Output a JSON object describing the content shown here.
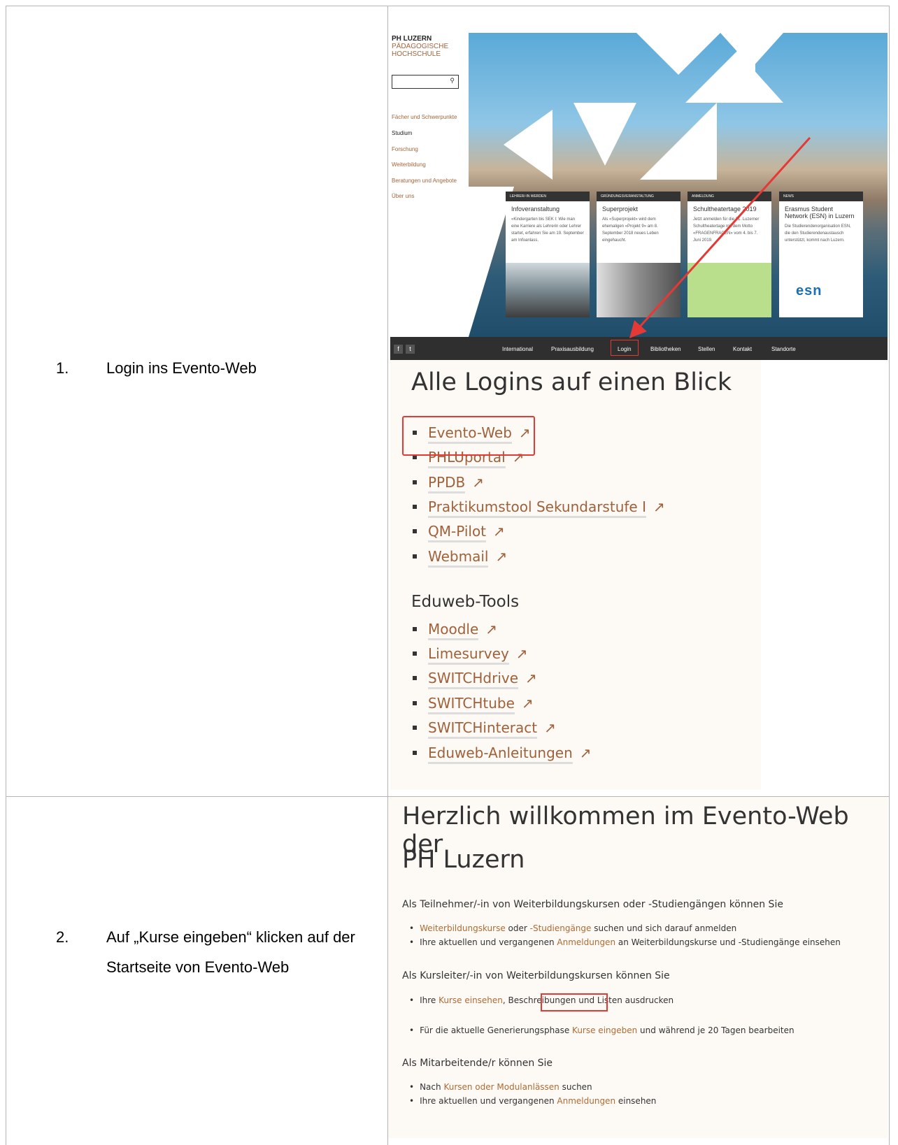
{
  "steps": [
    {
      "num": "1.",
      "text": "Login ins Evento-Web"
    },
    {
      "num": "2.",
      "text": "Auf „Kurse eingeben“ klicken auf der Startseite von Evento-Web"
    }
  ],
  "phlu": {
    "logo_line1": "PH LUZERN",
    "logo_line2": "PÄDAGOGISCHE HOCHSCHULE",
    "search_icon": "search-icon",
    "nav": [
      "Fächer und Schwerpunkte",
      "Studium",
      "Forschung",
      "Weiterbildung",
      "Beratungen und Angebote",
      "Über uns"
    ],
    "cards": [
      {
        "category": "LEHRER/-IN WERDEN",
        "title": "Infoveranstaltung",
        "body": "«Kindergarten bis SEK I: Wie man eine Karriere als Lehrerin oder Lehrer startet, erfahren Sie am 19. September am Infoanlass."
      },
      {
        "category": "GRÜNDUNGSVERANSTALTUNG",
        "title": "Superprojekt",
        "body": "Als «Superprojekt» wird dem ehemaligen «Projekt 9» am 8. September 2018 neues Leben eingehaucht."
      },
      {
        "category": "ANMELDUNG",
        "title": "Schultheatertage 2019",
        "body": "Jetzt anmelden für die 31. Luzerner Schultheatertage mit dem Motto «FRAGENFRAGEN» vom 4. bis 7. Juni 2019."
      },
      {
        "category": "NEWS",
        "title": "Erasmus Student Network (ESN) in Luzern",
        "body": "Die Studierendenorganisation ESN, die den Studierendenaustausch unterstützt, kommt nach Luzern."
      }
    ],
    "esn_logo": "esn",
    "social": [
      "f",
      "t"
    ],
    "footer_nav": [
      "International",
      "Praxisausbildung",
      "Login",
      "Bibliotheken",
      "Stellen",
      "Kontakt",
      "Standorte"
    ]
  },
  "logins": {
    "title": "Alle Logins auf einen Blick",
    "links": [
      "Evento-Web",
      "PHLUportal",
      "PPDB",
      "Praktikumstool Sekundarstufe I",
      "QM-Pilot",
      "Webmail"
    ],
    "subtitle": "Eduweb-Tools",
    "tools": [
      "Moodle",
      "Limesurvey",
      "SWITCHdrive",
      "SWITCHtube",
      "SWITCHinteract",
      "Eduweb-Anleitungen"
    ],
    "arrow": "↗"
  },
  "evento": {
    "title_line1": "Herzlich willkommen im Evento-Web der",
    "title_line2": "PH Luzern",
    "sec1": "Als Teilnehmer/-in von Weiterbildungskursen oder -Studiengängen können Sie",
    "sec1_item1": {
      "link1": "Weiterbildungskurse",
      "t1": " oder ",
      "link2": "-Studiengänge",
      "t2": " suchen und sich darauf anmelden"
    },
    "sec1_item2": {
      "t1": "Ihre aktuellen und vergangenen ",
      "link": "Anmeldungen",
      "t2": " an Weiterbildungskurse und -Studiengänge einsehen"
    },
    "sec2": "Als Kursleiter/-in von Weiterbildungskursen können Sie",
    "sec2_item1": {
      "t1": "Ihre ",
      "link": "Kurse einsehen",
      "t2": ", Beschreibungen und Listen ausdrucken"
    },
    "sec2_item2": {
      "t1": "Für die aktuelle Generierungsphase ",
      "link": "Kurse eingeben",
      "t2": " und während je 20 Tagen bearbeiten"
    },
    "sec3": "Als Mitarbeitende/r können Sie",
    "sec3_item1": {
      "t1": "Nach ",
      "link": "Kursen oder Modulanlässen",
      "t2": "  suchen"
    },
    "sec3_item2": {
      "t1": "Ihre aktuellen und vergangenen ",
      "link": "Anmeldungen",
      "t2": " einsehen"
    }
  },
  "colors": {
    "link": "#a0613a",
    "highlight": "#e53935"
  }
}
